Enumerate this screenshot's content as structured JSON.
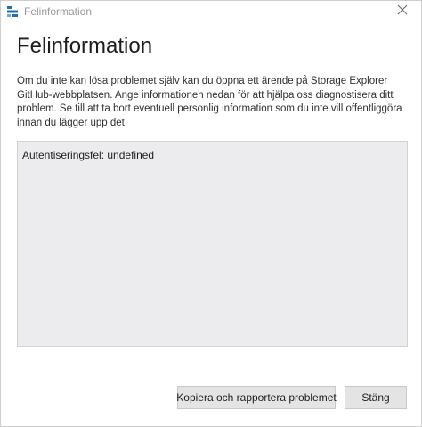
{
  "window": {
    "title": "Felinformation",
    "app_icon": "storage-explorer-icon",
    "close_icon": "close-icon"
  },
  "dialog": {
    "heading": "Felinformation",
    "message": "Om du inte kan lösa problemet själv kan du öppna ett ärende på Storage Explorer GitHub-webbplatsen. Ange informationen nedan för att hjälpa oss diagnostisera ditt problem. Se till att ta bort eventuell personlig information som du inte vill offentliggöra innan du lägger upp det.",
    "details": "Autentiseringsfel: undefined"
  },
  "buttons": {
    "report_label": "Kopiera och rapportera problemet",
    "close_label": "Stäng"
  },
  "colors": {
    "details_background": "#ecebee",
    "button_background": "#e4e4e4",
    "title_text": "#9a9a9a",
    "app_icon_blue": "#1f6fb5"
  }
}
